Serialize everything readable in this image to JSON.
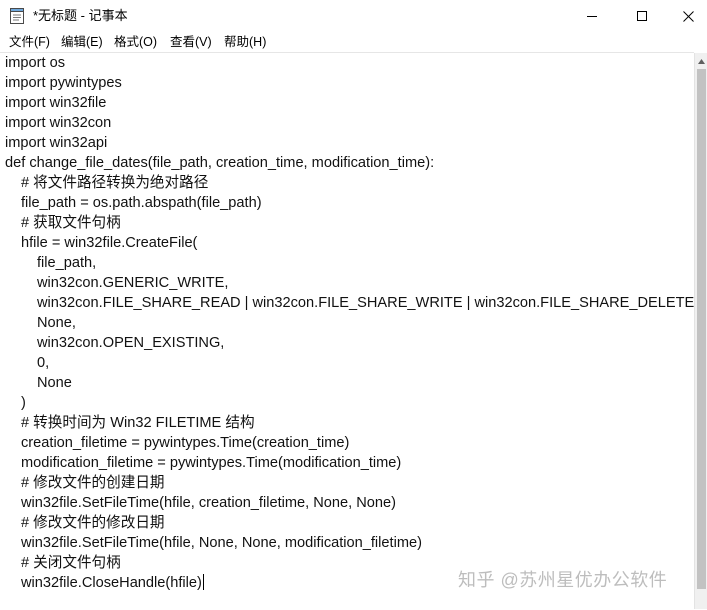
{
  "window": {
    "title": "*无标题 - 记事本"
  },
  "menu": {
    "items": [
      "文件(F)",
      "编辑(E)",
      "格式(O)",
      "查看(V)",
      "帮助(H)"
    ]
  },
  "editor": {
    "lines": [
      "import os",
      "import pywintypes",
      "import win32file",
      "import win32con",
      "import win32api",
      "def change_file_dates(file_path, creation_time, modification_time):",
      "# 将文件路径转换为绝对路径",
      "file_path = os.path.abspath(file_path)",
      "# 获取文件句柄",
      "hfile = win32file.CreateFile(",
      "file_path,",
      "win32con.GENERIC_WRITE,",
      "win32con.FILE_SHARE_READ | win32con.FILE_SHARE_WRITE | win32con.FILE_SHARE_DELETE,",
      "None,",
      "win32con.OPEN_EXISTING,",
      "0,",
      "None",
      ")",
      "# 转换时间为 Win32 FILETIME 结构",
      "creation_filetime = pywintypes.Time(creation_time)",
      "modification_filetime = pywintypes.Time(modification_time)",
      "# 修改文件的创建日期",
      "win32file.SetFileTime(hfile, creation_filetime, None, None)",
      "# 修改文件的修改日期",
      "win32file.SetFileTime(hfile, None, None, modification_filetime)",
      "# 关闭文件句柄",
      "win32file.CloseHandle(hfile)"
    ]
  },
  "watermark": {
    "text": "知乎 @苏州星优办公软件"
  }
}
